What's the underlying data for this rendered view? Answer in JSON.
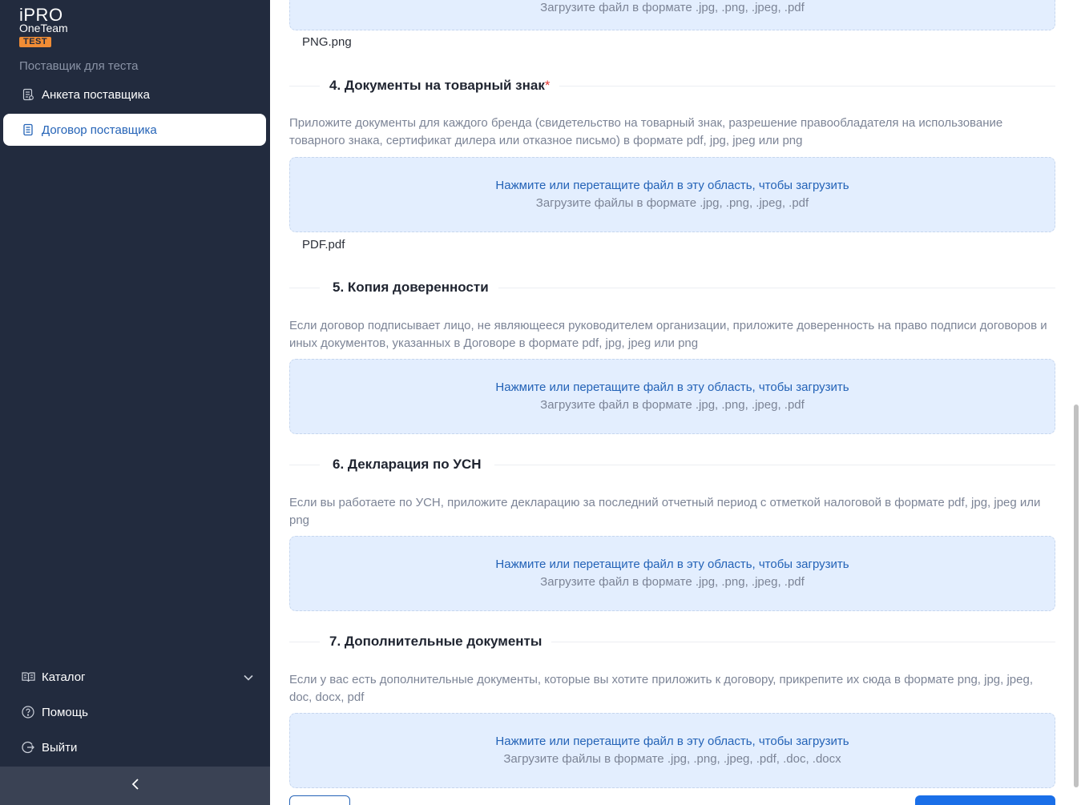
{
  "sidebar": {
    "logo": {
      "name": "iPRO",
      "subtitle": "OneTeam",
      "badge": "TEST"
    },
    "supplier": "Поставщик для теста",
    "nav": [
      {
        "label": "Анкета поставщика",
        "icon": "document-list-icon"
      },
      {
        "label": "Договор поставщика",
        "icon": "contract-icon"
      }
    ],
    "bottom_nav": [
      {
        "label": "Каталог",
        "icon": "book-open-icon"
      },
      {
        "label": "Помощь",
        "icon": "help-circle-icon"
      },
      {
        "label": "Выйти",
        "icon": "logout-icon"
      }
    ],
    "collapse_icon": "chevron-left-icon"
  },
  "main": {
    "prev_upload": {
      "sub": "Загрузите файл в формате .jpg, .png, .jpeg, .pdf",
      "file": "PNG.png"
    },
    "sections": [
      {
        "title": "4. Документы на товарный знак",
        "required_mark": "*",
        "desc": "Приложите документы для каждого бренда (свидетельство на товарный знак, разрешение правообладателя на использование товарного знака, сертификат дилера или отказное письмо) в формате pdf, jpg, jpeg или png",
        "drop_main": "Нажмите или перетащите файл в эту область, чтобы загрузить",
        "drop_sub": "Загрузите файлы в формате .jpg, .png, .jpeg, .pdf",
        "file": "PDF.pdf"
      },
      {
        "title": "5. Копия доверенности",
        "desc": "Если договор подписывает лицо, не являющееся руководителем организации, приложите доверенность на право подписи договоров и иных документов, указанных в Договоре в формате pdf, jpg, jpeg или png",
        "drop_main": "Нажмите или перетащите файл в эту область, чтобы загрузить",
        "drop_sub": "Загрузите файл в формате .jpg, .png, .jpeg, .pdf"
      },
      {
        "title": "6. Декларация по УСН",
        "desc": "Если вы работаете по УСН, приложите декларацию за последний отчетный период с отметкой налоговой в формате pdf, jpg, jpeg или png",
        "drop_main": "Нажмите или перетащите файл в эту область, чтобы загрузить",
        "drop_sub": "Загрузите файл в формате .jpg, .png, .jpeg, .pdf"
      },
      {
        "title": "7. Дополнительные документы",
        "desc": "Если у вас есть дополнительные документы, которые вы хотите приложить к договору, прикрепите их сюда в формате png, jpg, jpeg, doc, docx, pdf",
        "drop_main": "Нажмите или перетащите файл в эту область, чтобы загрузить",
        "drop_sub": "Загрузите файлы в формате .jpg, .png, .jpeg, .pdf, .doc, .docx"
      }
    ]
  },
  "colors": {
    "sidebar_bg": "#222b3e",
    "accent": "#2463b7",
    "dropzone_bg": "#e3eefe",
    "badge": "#f08c35",
    "primary_button": "#1a6fe8"
  }
}
